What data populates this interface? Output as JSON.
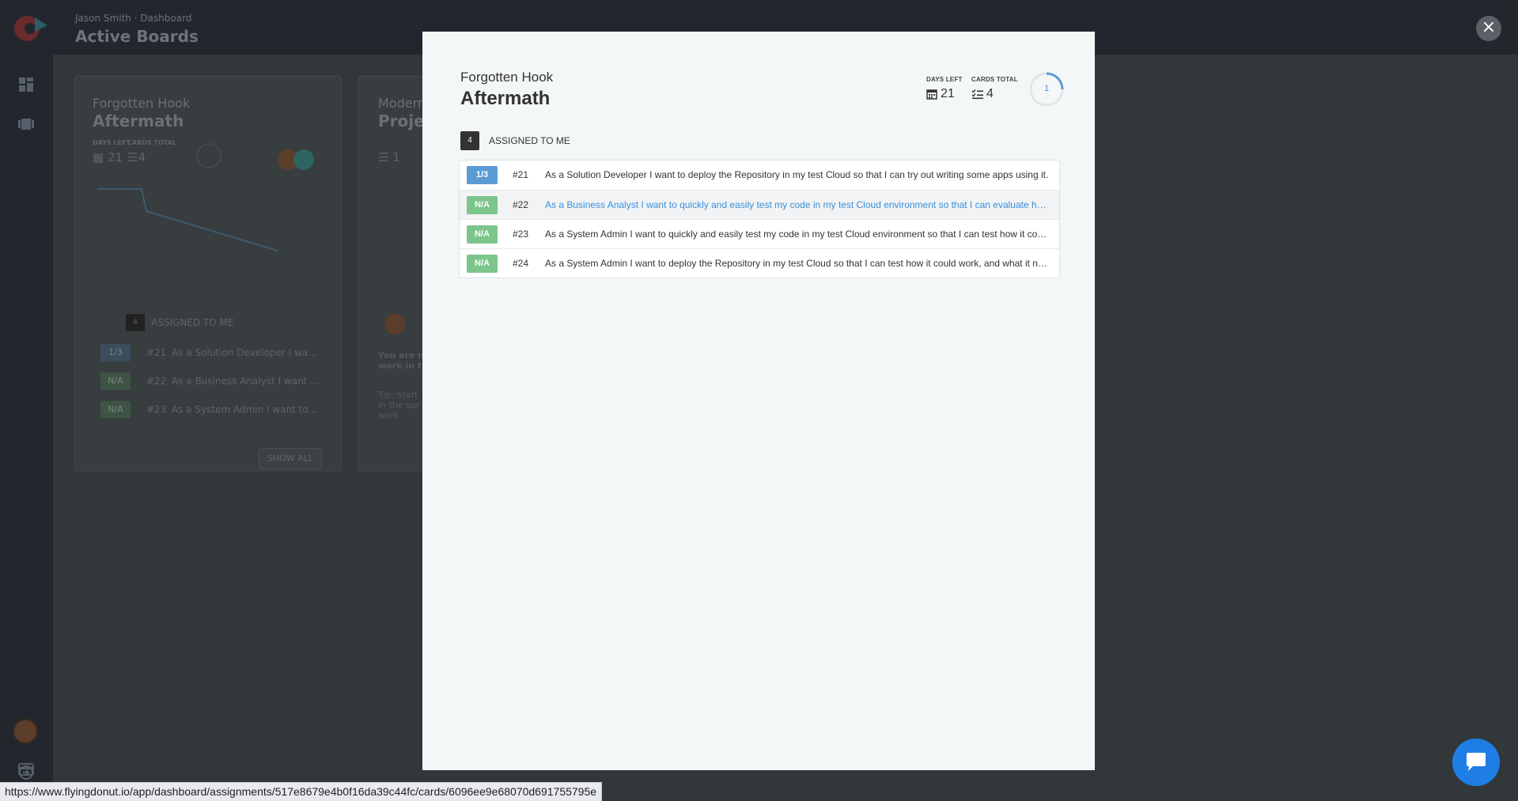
{
  "header": {
    "breadcrumb": "Jason Smith · Dashboard",
    "title": "Active Boards"
  },
  "boards": [
    {
      "project": "Forgotten Hook",
      "name": "Aftermath",
      "days_left_label": "DAYS LEFT",
      "days_left": "21",
      "cards_total_label": "CARDS TOTAL",
      "cards_total": "4",
      "assigned_count": "4",
      "assigned_label": "ASSIGNED TO ME",
      "rows": [
        {
          "badge": "1/3",
          "num": "#21",
          "text": "As a Solution Developer I want to deploy the Repository in my test Cloud"
        },
        {
          "badge": "N/A",
          "num": "#22",
          "text": "As a Business Analyst I want to quickly and easily test my code"
        },
        {
          "badge": "N/A",
          "num": "#23",
          "text": "As a System Admin I want to quickly and easily test my code"
        }
      ],
      "show_all": "SHOW ALL"
    },
    {
      "project": "Modern",
      "name": "Proje",
      "cards_total": "1",
      "msg": "You are n\nwork in th",
      "tip": "Tip: Start\nin the spr\nwork."
    }
  ],
  "modal": {
    "project": "Forgotten Hook",
    "title": "Aftermath",
    "days_left_label": "DAYS LEFT",
    "days_left": "21",
    "cards_total_label": "CARDS TOTAL",
    "cards_total": "4",
    "ring_value": "1",
    "assigned_count": "4",
    "assigned_label": "ASSIGNED TO ME",
    "cards": [
      {
        "badge": "1/3",
        "badge_color": "#5b9bd5",
        "num": "#21",
        "text": "As a Solution Developer I want to deploy the Repository in my test Cloud so that I can try out writing some apps using it."
      },
      {
        "badge": "N/A",
        "badge_color": "#7cc58b",
        "num": "#22",
        "text": "As a Business Analyst I want to quickly and easily test my code in my test Cloud environment so that I can evaluate how it works."
      },
      {
        "badge": "N/A",
        "badge_color": "#7cc58b",
        "num": "#23",
        "text": "As a System Admin I want to quickly and easily test my code in my test Cloud environment so that I can test how it could work."
      },
      {
        "badge": "N/A",
        "badge_color": "#7cc58b",
        "num": "#24",
        "text": "As a System Admin I want to deploy the Repository in my test Cloud so that I can test how it could work, and what it needs."
      }
    ]
  },
  "close_label": "×",
  "status_url": "https://www.flyingdonut.io/app/dashboard/assignments/517e8679e4b0f16da39c44fc/cards/6096ee9e68070d691755795e",
  "icons": {
    "close": "close-icon",
    "chat": "chat-icon",
    "calendar": "calendar-icon",
    "tasks": "checklist-icon"
  }
}
